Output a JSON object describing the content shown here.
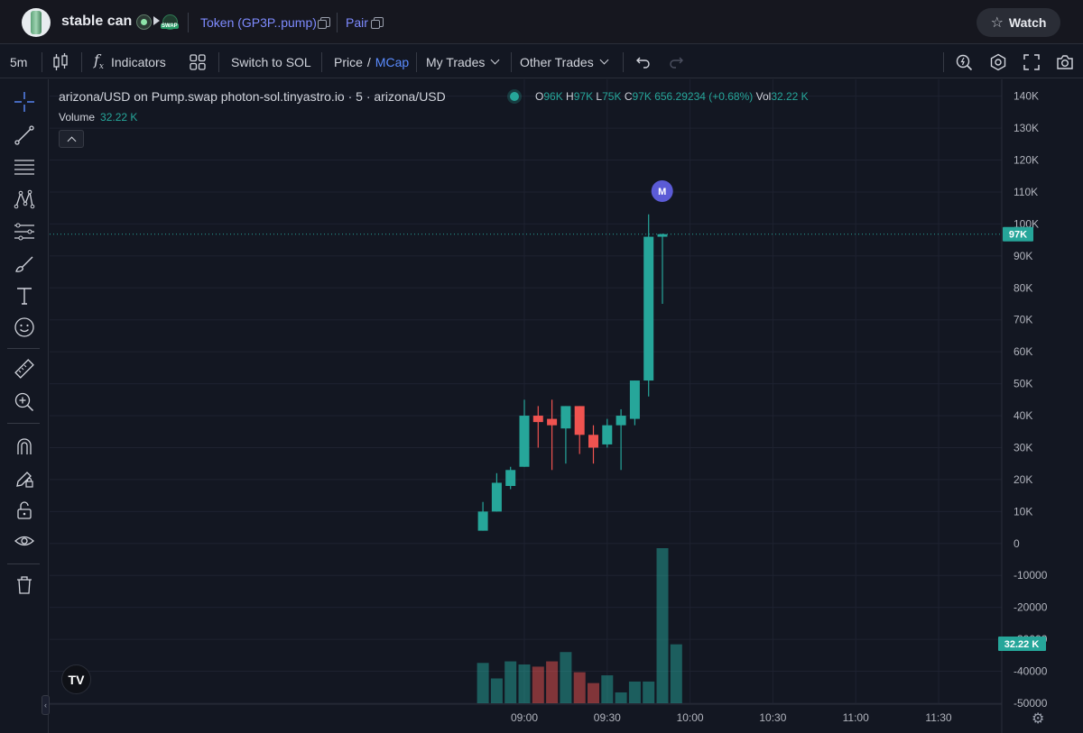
{
  "header": {
    "token_name": "stable can",
    "token_link": "Token (GP3P..pump)",
    "pair_link": "Pair",
    "watch_label": "Watch"
  },
  "toolbar": {
    "interval": "5m",
    "indicators_label": "Indicators",
    "switch_label": "Switch to SOL",
    "price_label": "Price",
    "price_sep": "/",
    "mcap_label": "MCap",
    "my_trades_label": "My Trades",
    "other_trades_label": "Other Trades"
  },
  "legend": {
    "symbol_line": "arizona/USD on Pump.swap photon-sol.tinyastro.io · 5 · arizona/USD",
    "o_label": "O",
    "o_value": "96K",
    "h_label": "H",
    "h_value": "97K",
    "l_label": "L",
    "l_value": "75K",
    "c_label": "C",
    "c_value": "97K",
    "change": "656.29234 (+0.68%)",
    "vol_label": "Vol",
    "vol_value": "32.22 K",
    "volume_label": "Volume",
    "volume_value": "32.22 K"
  },
  "tv_logo_text": "TV",
  "colors": {
    "up": "#26a69a",
    "down": "#ef5350",
    "background": "#131722",
    "accent": "#5b8cff",
    "marker": "#5b5bd6"
  },
  "chart_data": {
    "type": "candlestick",
    "timeframe": "5",
    "x_tick_labels": [
      "09:00",
      "09:30",
      "10:00",
      "10:30",
      "11:00",
      "11:30"
    ],
    "x_tick_times": [
      540,
      570,
      600,
      630,
      660,
      690
    ],
    "price_axis_labels": [
      "140K",
      "130K",
      "120K",
      "110K",
      "100K",
      "90K",
      "80K",
      "70K",
      "60K",
      "50K",
      "40K",
      "30K",
      "20K",
      "10K",
      "0",
      "-10000",
      "-20000",
      "-30000",
      "-40000",
      "-50000"
    ],
    "price_axis_values": [
      140000,
      130000,
      120000,
      110000,
      100000,
      90000,
      80000,
      70000,
      60000,
      50000,
      40000,
      30000,
      20000,
      10000,
      0,
      -10000,
      -20000,
      -30000,
      -40000,
      -50000
    ],
    "ylim": [
      -50000,
      143000
    ],
    "current_price_label": "97K",
    "current_price": 96800,
    "current_volume_label": "32.22 K",
    "marker_label": "M",
    "marker_candle_index": 12,
    "candles": [
      {
        "t": 525,
        "o": 4000,
        "h": 13000,
        "l": 4000,
        "c": 10000
      },
      {
        "t": 530,
        "o": 10000,
        "h": 22000,
        "l": 10000,
        "c": 19000
      },
      {
        "t": 535,
        "o": 18000,
        "h": 24000,
        "l": 17000,
        "c": 23000
      },
      {
        "t": 540,
        "o": 24000,
        "h": 45000,
        "l": 24000,
        "c": 40000
      },
      {
        "t": 545,
        "o": 40000,
        "h": 43000,
        "l": 30000,
        "c": 38000
      },
      {
        "t": 550,
        "o": 39000,
        "h": 45000,
        "l": 23000,
        "c": 37000
      },
      {
        "t": 555,
        "o": 36000,
        "h": 43000,
        "l": 25000,
        "c": 43000
      },
      {
        "t": 560,
        "o": 43000,
        "h": 43000,
        "l": 28000,
        "c": 34000
      },
      {
        "t": 565,
        "o": 34000,
        "h": 37000,
        "l": 25000,
        "c": 30000
      },
      {
        "t": 570,
        "o": 31000,
        "h": 39000,
        "l": 30000,
        "c": 37000
      },
      {
        "t": 575,
        "o": 37000,
        "h": 42000,
        "l": 23000,
        "c": 40000
      },
      {
        "t": 580,
        "o": 39000,
        "h": 51000,
        "l": 37000,
        "c": 51000
      },
      {
        "t": 585,
        "o": 51000,
        "h": 103000,
        "l": 46000,
        "c": 96000
      },
      {
        "t": 590,
        "o": 96000,
        "h": 97000,
        "l": 75000,
        "c": 96800
      }
    ],
    "volume": [
      13000,
      8000,
      13500,
      12500,
      11800,
      13500,
      16500,
      10000,
      6500,
      9000,
      3500,
      7000,
      7000,
      50000,
      19000
    ]
  }
}
